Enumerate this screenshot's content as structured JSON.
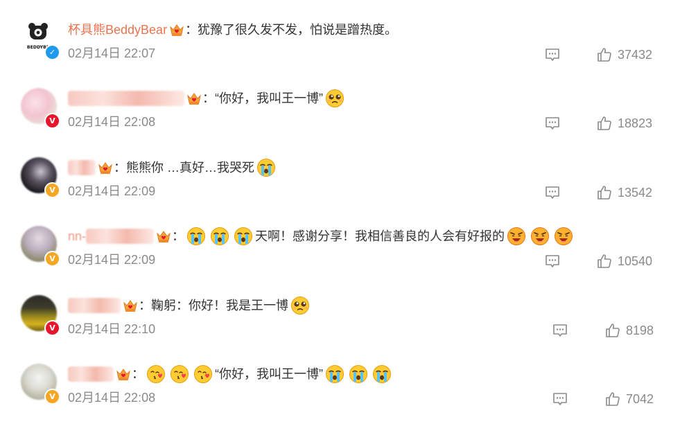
{
  "colors": {
    "username": "#eb7350",
    "text": "#333333",
    "meta": "#8a8a8a",
    "verified_blue": "#1d9bf0",
    "verified_orange": "#f5a623",
    "verified_red": "#e6162d"
  },
  "comments": [
    {
      "username": "杯具熊BeddyBear",
      "text": "：犹豫了很久发不发，怕说是蹭热度。",
      "time": "02月14日 22:07",
      "likes": "37432",
      "avatar_logo": "BEDDYBE",
      "badge": "verified-blue"
    },
    {
      "username": "",
      "text": "：“你好，我叫王一博”",
      "time": "02月14日 22:08",
      "likes": "18823",
      "badge": "verified-red"
    },
    {
      "username": "",
      "text": "：熊熊你 …真好…我哭死",
      "time": "02月14日 22:09",
      "likes": "13542",
      "badge": "verified-orange"
    },
    {
      "username": "nn-",
      "text": "：",
      "text2": "天啊！感谢分享！我相信善良的人会有好报的",
      "time": "02月14日 22:09",
      "likes": "10540",
      "badge": "verified-orange"
    },
    {
      "username": "",
      "text": "：鞠躬：你好！我是王一博",
      "time": "02月14日 22:10",
      "likes": "8198",
      "badge": "verified-red"
    },
    {
      "username": "",
      "text": "：",
      "text2": "“你好，我叫王一博”",
      "time": "02月14日 22:08",
      "likes": "7042",
      "badge": "verified-orange"
    }
  ]
}
